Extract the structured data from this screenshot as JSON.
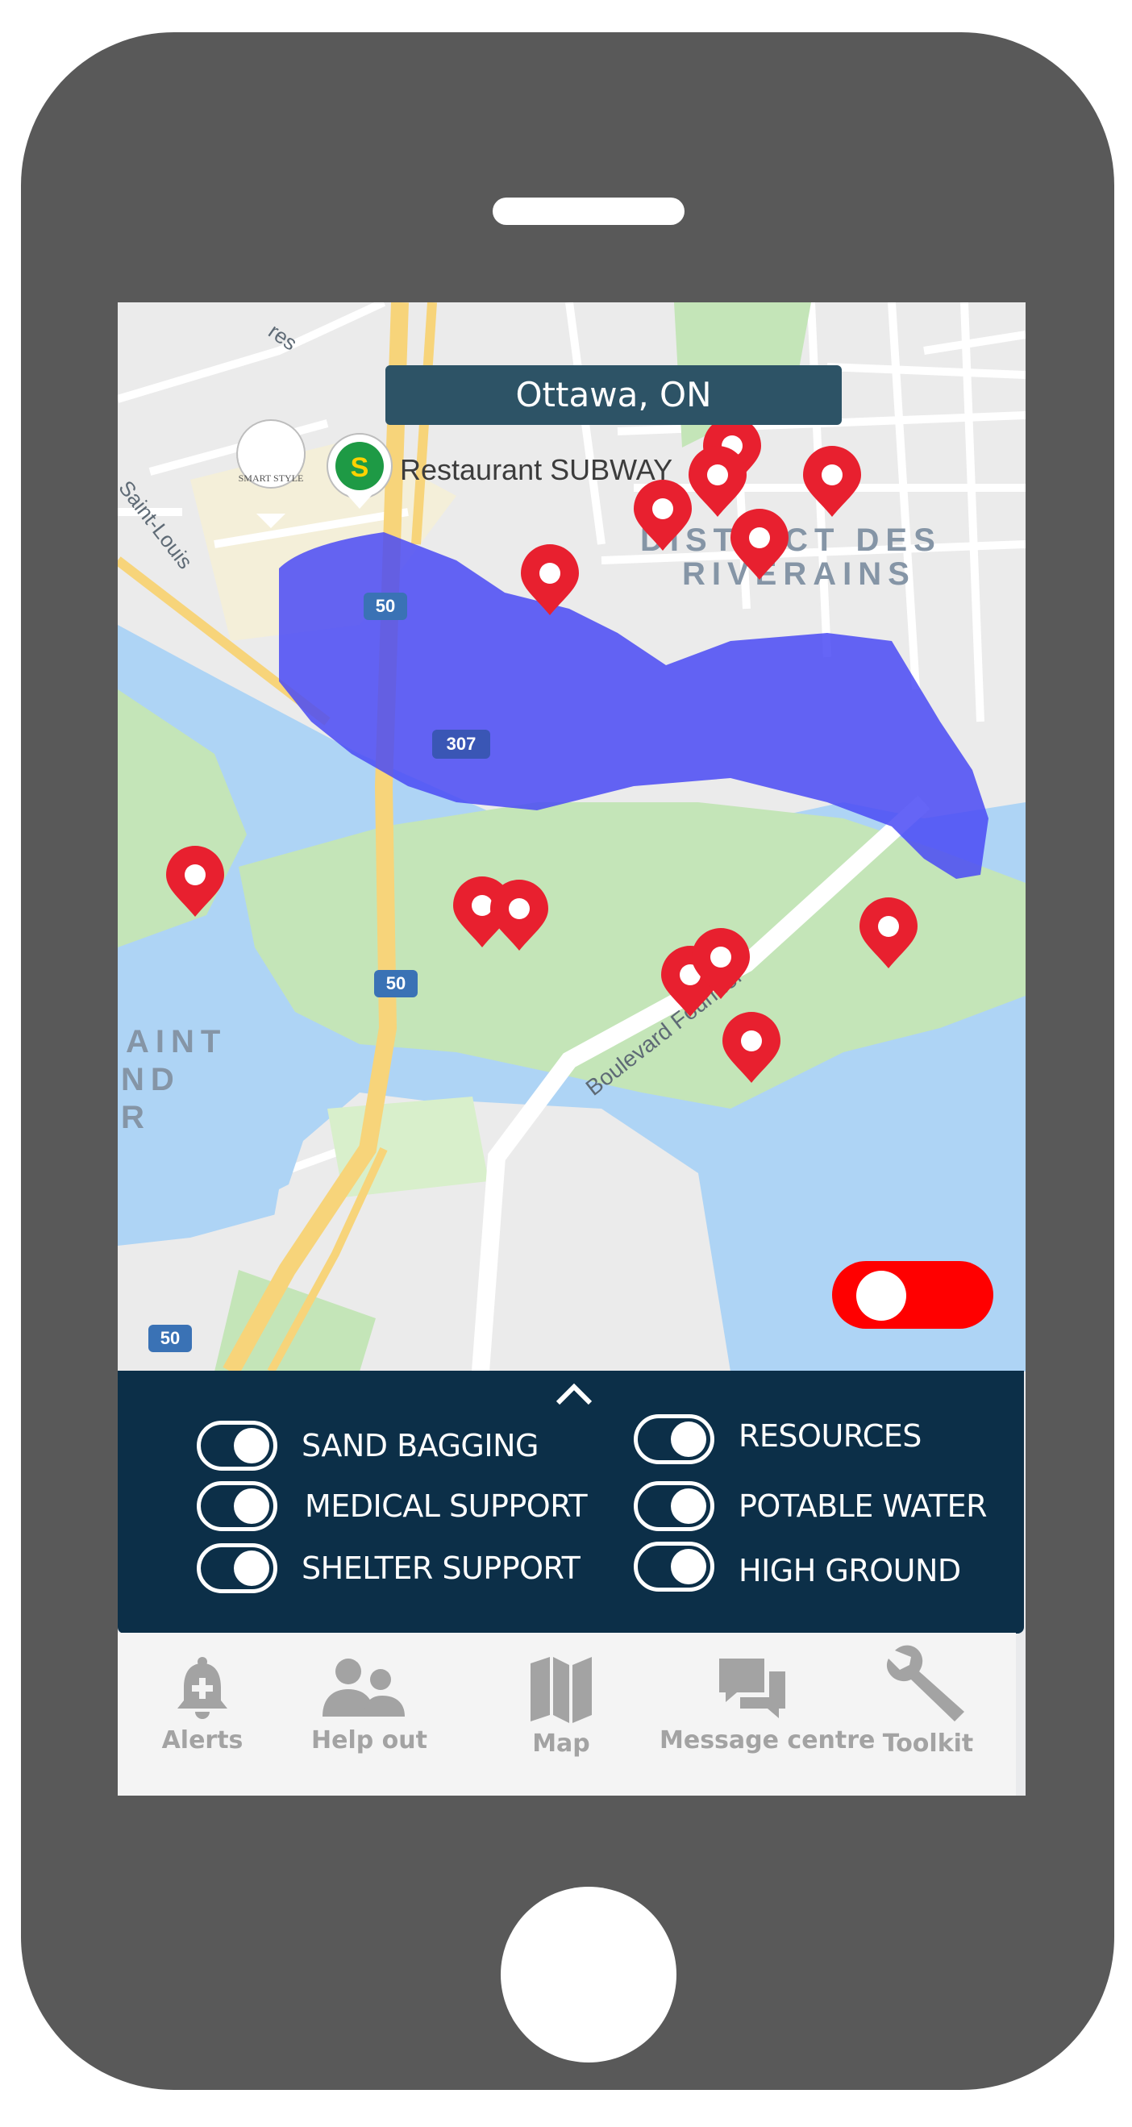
{
  "location": {
    "title": "Ottawa, ON"
  },
  "map": {
    "labels": {
      "restaurant": "Restaurant SUBWAY",
      "district_line1": "DISTRICT DES",
      "district_line2": "RIVERAINS",
      "street": "Boulevard Fournier",
      "saint_line1": "AINT",
      "saint_line2": "ND",
      "saint_line3": "R",
      "road_left": "Saint-Louis",
      "road_top": "res",
      "smart_style": "SMART STYLE"
    },
    "route_badges": [
      "50",
      "307",
      "50",
      "50"
    ],
    "flood_overlay_color": "#4a4af5",
    "pin_color": "#e8202f",
    "pin_count": 15,
    "overlay_toggle_on": true
  },
  "filters": {
    "expand_icon": "chevron-up-icon",
    "items": [
      {
        "label": "SAND BAGGING",
        "on": true
      },
      {
        "label": "MEDICAL SUPPORT",
        "on": true
      },
      {
        "label": "SHELTER SUPPORT",
        "on": true
      },
      {
        "label": "RESOURCES",
        "on": true
      },
      {
        "label": "POTABLE WATER",
        "on": true
      },
      {
        "label": "HIGH GROUND",
        "on": true
      }
    ]
  },
  "tabs": [
    {
      "label": "Alerts",
      "icon": "bell-plus-icon"
    },
    {
      "label": "Help out",
      "icon": "people-icon"
    },
    {
      "label": "Map",
      "icon": "map-icon"
    },
    {
      "label": "Message centre",
      "icon": "chat-bubbles-icon"
    },
    {
      "label": "Toolkit",
      "icon": "wrench-icon"
    }
  ],
  "colors": {
    "phone_body": "#595959",
    "panel_bg": "#0c2f48",
    "banner_bg": "#2d5366",
    "toggle_red": "#ff0000"
  }
}
